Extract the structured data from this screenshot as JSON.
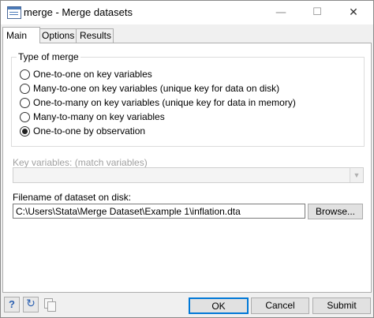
{
  "window": {
    "title": "merge - Merge datasets",
    "minimize_glyph": "—",
    "maximize_glyph": "☐",
    "close_glyph": "✕"
  },
  "tabs": [
    {
      "label": "Main",
      "active": true
    },
    {
      "label": "Options",
      "active": false
    },
    {
      "label": "Results",
      "active": false
    }
  ],
  "merge_type": {
    "legend": "Type of merge",
    "options": [
      {
        "label": "One-to-one on key variables",
        "checked": false
      },
      {
        "label": "Many-to-one on key variables (unique key for data on disk)",
        "checked": false
      },
      {
        "label": "One-to-many on key variables (unique key for data in memory)",
        "checked": false
      },
      {
        "label": "Many-to-many on key variables",
        "checked": false
      },
      {
        "label": "One-to-one by observation",
        "checked": true
      }
    ]
  },
  "key_variables": {
    "label": "Key variables: (match variables)",
    "value": ""
  },
  "file": {
    "label": "Filename of dataset on disk:",
    "value": "C:\\Users\\Stata\\Merge Dataset\\Example 1\\inflation.dta",
    "browse_label": "Browse..."
  },
  "footer": {
    "help_glyph": "?",
    "reset_glyph": "↻",
    "ok_label": "OK",
    "cancel_label": "Cancel",
    "submit_label": "Submit"
  },
  "colors": {
    "accent": "#0078d7",
    "link_icon": "#2a5fb0"
  }
}
